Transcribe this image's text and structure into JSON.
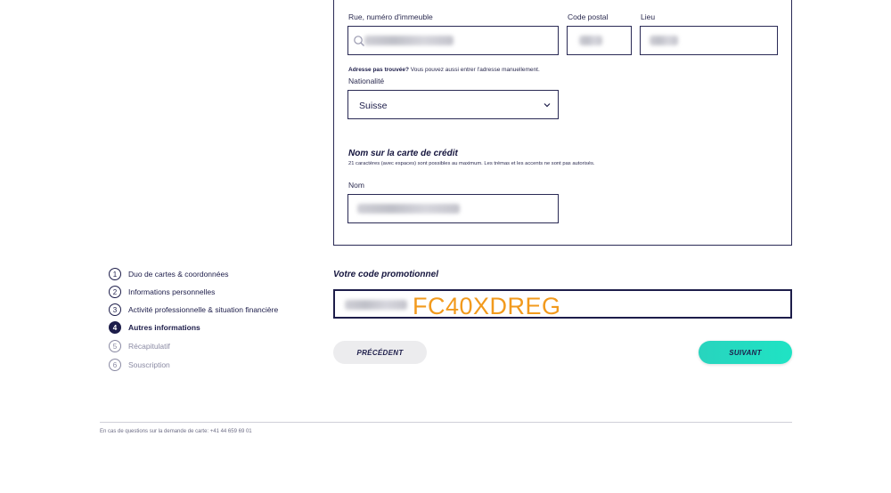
{
  "address": {
    "street_label": "Rue, numéro d'immeuble",
    "postal_label": "Code postal",
    "city_label": "Lieu",
    "not_found_bold": "Adresse pas trouvée?",
    "not_found_text": " Vous pouvez aussi entrer l'adresse manuellement."
  },
  "nationality": {
    "label": "Nationalité",
    "value": "Suisse"
  },
  "card_name": {
    "title": "Nom sur la carte de crédit",
    "subtitle": "21 caractères (avec espaces) sont possibles au maximum. Les trémas et les accents ne sont pas autorisés.",
    "label": "Nom"
  },
  "steps": [
    {
      "num": "1",
      "label": "Duo de cartes & coordonnées"
    },
    {
      "num": "2",
      "label": "Informations personnelles"
    },
    {
      "num": "3",
      "label": "Activité professionnelle & situation financière"
    },
    {
      "num": "4",
      "label": "Autres informations"
    },
    {
      "num": "5",
      "label": "Récapitulatif"
    },
    {
      "num": "6",
      "label": "Souscription"
    }
  ],
  "promo": {
    "title": "Votre code promotionnel",
    "code": "FC40XDREG"
  },
  "buttons": {
    "prev": "PRÉCÉDENT",
    "next": "SUIVANT"
  },
  "footer": {
    "text": "En cas de questions sur la demande de carte: +41 44 659 69 01"
  },
  "colors": {
    "navy": "#1d1d4a",
    "accent": "#1fe3c4",
    "promo": "#f29a1d"
  }
}
